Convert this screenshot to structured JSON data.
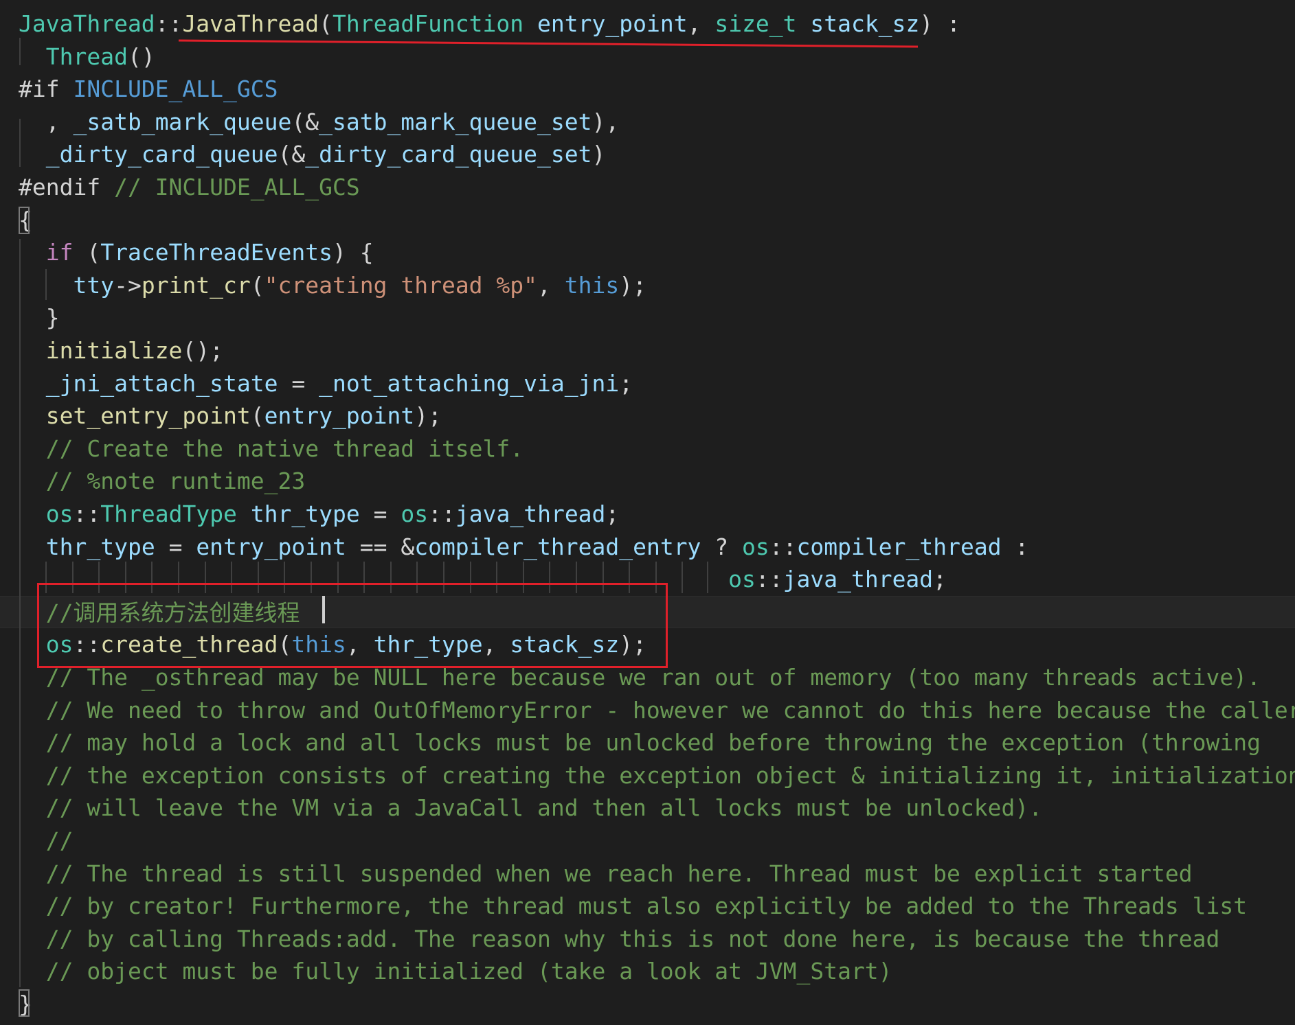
{
  "editor": {
    "theme_background": "#1e1e1e",
    "annotation_color": "#e0202a",
    "lines": [
      {
        "id": "l1",
        "parts": [
          {
            "t": "JavaThread",
            "c": "type"
          },
          {
            "t": "::",
            "c": "op"
          },
          {
            "t": "JavaThread",
            "c": "fn"
          },
          {
            "t": "(",
            "c": "op"
          },
          {
            "t": "ThreadFunction",
            "c": "type"
          },
          {
            "t": " ",
            "c": "op"
          },
          {
            "t": "entry_point",
            "c": "var"
          },
          {
            "t": ", ",
            "c": "op"
          },
          {
            "t": "size_t",
            "c": "type"
          },
          {
            "t": " ",
            "c": "op"
          },
          {
            "t": "stack_sz",
            "c": "var"
          },
          {
            "t": ") :",
            "c": "op"
          }
        ]
      },
      {
        "id": "l2",
        "parts": [
          {
            "t": "  ",
            "c": "op"
          },
          {
            "t": "Thread",
            "c": "type"
          },
          {
            "t": "()",
            "c": "op"
          }
        ]
      },
      {
        "id": "l3",
        "parts": [
          {
            "t": "#if ",
            "c": "pp"
          },
          {
            "t": "INCLUDE_ALL_GCS",
            "c": "mac"
          }
        ]
      },
      {
        "id": "l4",
        "parts": [
          {
            "t": "  , ",
            "c": "op"
          },
          {
            "t": "_satb_mark_queue",
            "c": "var"
          },
          {
            "t": "(&",
            "c": "op"
          },
          {
            "t": "_satb_mark_queue_set",
            "c": "var"
          },
          {
            "t": "),",
            "c": "op"
          }
        ]
      },
      {
        "id": "l5",
        "parts": [
          {
            "t": "  ",
            "c": "op"
          },
          {
            "t": "_dirty_card_queue",
            "c": "var"
          },
          {
            "t": "(&",
            "c": "op"
          },
          {
            "t": "_dirty_card_queue_set",
            "c": "var"
          },
          {
            "t": ")",
            "c": "op"
          }
        ]
      },
      {
        "id": "l6",
        "parts": [
          {
            "t": "#endif ",
            "c": "pp"
          },
          {
            "t": "// INCLUDE_ALL_GCS",
            "c": "cmt"
          }
        ]
      },
      {
        "id": "l7",
        "parts": [
          {
            "t": "{",
            "c": "op"
          }
        ]
      },
      {
        "id": "l8",
        "parts": [
          {
            "t": "  ",
            "c": "op"
          },
          {
            "t": "if",
            "c": "ctl"
          },
          {
            "t": " (",
            "c": "op"
          },
          {
            "t": "TraceThreadEvents",
            "c": "var"
          },
          {
            "t": ") {",
            "c": "op"
          }
        ]
      },
      {
        "id": "l9",
        "parts": [
          {
            "t": "    ",
            "c": "op"
          },
          {
            "t": "tty",
            "c": "var"
          },
          {
            "t": "->",
            "c": "op"
          },
          {
            "t": "print_cr",
            "c": "fn"
          },
          {
            "t": "(",
            "c": "op"
          },
          {
            "t": "\"creating thread %p\"",
            "c": "str"
          },
          {
            "t": ", ",
            "c": "op"
          },
          {
            "t": "this",
            "c": "kw"
          },
          {
            "t": ");",
            "c": "op"
          }
        ]
      },
      {
        "id": "l10",
        "parts": [
          {
            "t": "  }",
            "c": "op"
          }
        ]
      },
      {
        "id": "l11",
        "parts": [
          {
            "t": "  ",
            "c": "op"
          },
          {
            "t": "initialize",
            "c": "fn"
          },
          {
            "t": "();",
            "c": "op"
          }
        ]
      },
      {
        "id": "l12",
        "parts": [
          {
            "t": "  ",
            "c": "op"
          },
          {
            "t": "_jni_attach_state",
            "c": "var"
          },
          {
            "t": " = ",
            "c": "op"
          },
          {
            "t": "_not_attaching_via_jni",
            "c": "var"
          },
          {
            "t": ";",
            "c": "op"
          }
        ]
      },
      {
        "id": "l13",
        "parts": [
          {
            "t": "  ",
            "c": "op"
          },
          {
            "t": "set_entry_point",
            "c": "fn"
          },
          {
            "t": "(",
            "c": "op"
          },
          {
            "t": "entry_point",
            "c": "var"
          },
          {
            "t": ");",
            "c": "op"
          }
        ]
      },
      {
        "id": "l14",
        "parts": [
          {
            "t": "  ",
            "c": "op"
          },
          {
            "t": "// Create the native thread itself.",
            "c": "cmt"
          }
        ]
      },
      {
        "id": "l15",
        "parts": [
          {
            "t": "  ",
            "c": "op"
          },
          {
            "t": "// %note runtime_23",
            "c": "cmt"
          }
        ]
      },
      {
        "id": "l16",
        "parts": [
          {
            "t": "  ",
            "c": "op"
          },
          {
            "t": "os",
            "c": "ns"
          },
          {
            "t": "::",
            "c": "op"
          },
          {
            "t": "ThreadType",
            "c": "type"
          },
          {
            "t": " ",
            "c": "op"
          },
          {
            "t": "thr_type",
            "c": "var"
          },
          {
            "t": " = ",
            "c": "op"
          },
          {
            "t": "os",
            "c": "ns"
          },
          {
            "t": "::",
            "c": "op"
          },
          {
            "t": "java_thread",
            "c": "var"
          },
          {
            "t": ";",
            "c": "op"
          }
        ]
      },
      {
        "id": "l17",
        "parts": [
          {
            "t": "  ",
            "c": "op"
          },
          {
            "t": "thr_type",
            "c": "var"
          },
          {
            "t": " = ",
            "c": "op"
          },
          {
            "t": "entry_point",
            "c": "var"
          },
          {
            "t": " == &",
            "c": "op"
          },
          {
            "t": "compiler_thread_entry",
            "c": "var"
          },
          {
            "t": " ? ",
            "c": "op"
          },
          {
            "t": "os",
            "c": "ns"
          },
          {
            "t": "::",
            "c": "op"
          },
          {
            "t": "compiler_thread",
            "c": "var"
          },
          {
            "t": " :",
            "c": "op"
          }
        ]
      },
      {
        "id": "l18",
        "parts": [
          {
            "t": "                                                    ",
            "c": "op"
          },
          {
            "t": "os",
            "c": "ns"
          },
          {
            "t": "::",
            "c": "op"
          },
          {
            "t": "java_thread",
            "c": "var"
          },
          {
            "t": ";",
            "c": "op"
          }
        ]
      },
      {
        "id": "l19",
        "parts": [
          {
            "t": "  ",
            "c": "op"
          },
          {
            "t": "//调用系统方法创建线程",
            "c": "cmt"
          }
        ]
      },
      {
        "id": "l20",
        "parts": [
          {
            "t": "  ",
            "c": "op"
          },
          {
            "t": "os",
            "c": "ns"
          },
          {
            "t": "::",
            "c": "op"
          },
          {
            "t": "create_thread",
            "c": "fn"
          },
          {
            "t": "(",
            "c": "op"
          },
          {
            "t": "this",
            "c": "kw"
          },
          {
            "t": ", ",
            "c": "op"
          },
          {
            "t": "thr_type",
            "c": "var"
          },
          {
            "t": ", ",
            "c": "op"
          },
          {
            "t": "stack_sz",
            "c": "var"
          },
          {
            "t": ");",
            "c": "op"
          }
        ]
      },
      {
        "id": "l21",
        "parts": [
          {
            "t": "  ",
            "c": "op"
          },
          {
            "t": "// The _osthread may be NULL here because we ran out of memory (too many threads active).",
            "c": "cmt"
          }
        ]
      },
      {
        "id": "l22",
        "parts": [
          {
            "t": "  ",
            "c": "op"
          },
          {
            "t": "// We need to throw and OutOfMemoryError - however we cannot do this here because the caller",
            "c": "cmt"
          }
        ]
      },
      {
        "id": "l23",
        "parts": [
          {
            "t": "  ",
            "c": "op"
          },
          {
            "t": "// may hold a lock and all locks must be unlocked before throwing the exception (throwing",
            "c": "cmt"
          }
        ]
      },
      {
        "id": "l24",
        "parts": [
          {
            "t": "  ",
            "c": "op"
          },
          {
            "t": "// the exception consists of creating the exception object & initializing it, initialization",
            "c": "cmt"
          }
        ]
      },
      {
        "id": "l25",
        "parts": [
          {
            "t": "  ",
            "c": "op"
          },
          {
            "t": "// will leave the VM via a JavaCall and then all locks must be unlocked).",
            "c": "cmt"
          }
        ]
      },
      {
        "id": "l26",
        "parts": [
          {
            "t": "  ",
            "c": "op"
          },
          {
            "t": "//",
            "c": "cmt"
          }
        ]
      },
      {
        "id": "l27",
        "parts": [
          {
            "t": "  ",
            "c": "op"
          },
          {
            "t": "// The thread is still suspended when we reach here. Thread must be explicit started",
            "c": "cmt"
          }
        ]
      },
      {
        "id": "l28",
        "parts": [
          {
            "t": "  ",
            "c": "op"
          },
          {
            "t": "// by creator! Furthermore, the thread must also explicitly be added to the Threads list",
            "c": "cmt"
          }
        ]
      },
      {
        "id": "l29",
        "parts": [
          {
            "t": "  ",
            "c": "op"
          },
          {
            "t": "// by calling Threads:add. The reason why this is not done here, is because the thread",
            "c": "cmt"
          }
        ]
      },
      {
        "id": "l30",
        "parts": [
          {
            "t": "  ",
            "c": "op"
          },
          {
            "t": "// object must be fully initialized (take a look at JVM_Start)",
            "c": "cmt"
          }
        ]
      },
      {
        "id": "l31",
        "parts": [
          {
            "t": "}",
            "c": "op"
          }
        ]
      }
    ]
  }
}
